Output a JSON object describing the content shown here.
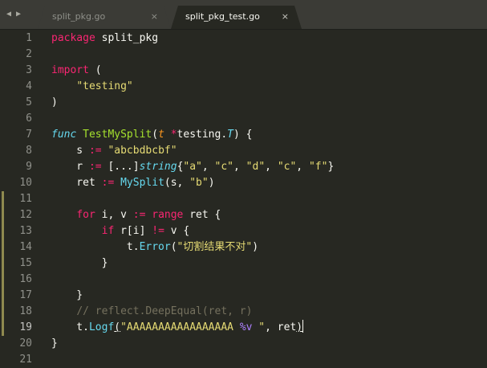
{
  "tabs": [
    {
      "label": "split_pkg.go",
      "close": "×",
      "active": false
    },
    {
      "label": "split_pkg_test.go",
      "close": "×",
      "active": true
    }
  ],
  "nav": {
    "back": "◀",
    "forward": "▶"
  },
  "lines": [
    {
      "num": "1",
      "tokens": [
        [
          "kw",
          "package"
        ],
        [
          "",
          " split_pkg"
        ]
      ]
    },
    {
      "num": "2",
      "tokens": []
    },
    {
      "num": "3",
      "tokens": [
        [
          "kw",
          "import"
        ],
        [
          "",
          " ("
        ]
      ]
    },
    {
      "num": "4",
      "tokens": [
        [
          "",
          "    "
        ],
        [
          "str",
          "\"testing\""
        ]
      ]
    },
    {
      "num": "5",
      "tokens": [
        [
          "",
          ")"
        ]
      ]
    },
    {
      "num": "6",
      "tokens": []
    },
    {
      "num": "7",
      "tokens": [
        [
          "it",
          "func"
        ],
        [
          "",
          " "
        ],
        [
          "fn",
          "TestMySplit"
        ],
        [
          "",
          "("
        ],
        [
          "param",
          "t"
        ],
        [
          "",
          " "
        ],
        [
          "kw",
          "*"
        ],
        [
          "",
          "testing."
        ],
        [
          "ty",
          "T"
        ],
        [
          "",
          ") {"
        ]
      ]
    },
    {
      "num": "8",
      "tokens": [
        [
          "",
          "    s "
        ],
        [
          "kw",
          ":="
        ],
        [
          "",
          " "
        ],
        [
          "str",
          "\"abcbdbcbf\""
        ]
      ]
    },
    {
      "num": "9",
      "tokens": [
        [
          "",
          "    r "
        ],
        [
          "kw",
          ":="
        ],
        [
          "",
          " [...]"
        ],
        [
          "ty",
          "string"
        ],
        [
          "",
          "{"
        ],
        [
          "str",
          "\"a\""
        ],
        [
          "",
          ", "
        ],
        [
          "str",
          "\"c\""
        ],
        [
          "",
          ", "
        ],
        [
          "str",
          "\"d\""
        ],
        [
          "",
          ", "
        ],
        [
          "str",
          "\"c\""
        ],
        [
          "",
          ", "
        ],
        [
          "str",
          "\"f\""
        ],
        [
          "",
          "}"
        ]
      ]
    },
    {
      "num": "10",
      "tokens": [
        [
          "",
          "    ret "
        ],
        [
          "kw",
          ":="
        ],
        [
          "",
          " "
        ],
        [
          "cyan",
          "MySplit"
        ],
        [
          "",
          "(s, "
        ],
        [
          "str",
          "\"b\""
        ],
        [
          "",
          ")"
        ]
      ]
    },
    {
      "num": "11",
      "tokens": []
    },
    {
      "num": "12",
      "tokens": [
        [
          "",
          "    "
        ],
        [
          "kw",
          "for"
        ],
        [
          "",
          " i, v "
        ],
        [
          "kw",
          ":="
        ],
        [
          "",
          " "
        ],
        [
          "kw",
          "range"
        ],
        [
          "",
          " ret {"
        ]
      ]
    },
    {
      "num": "13",
      "tokens": [
        [
          "",
          "        "
        ],
        [
          "kw",
          "if"
        ],
        [
          "",
          " r[i] "
        ],
        [
          "kw",
          "!="
        ],
        [
          "",
          " v {"
        ]
      ]
    },
    {
      "num": "14",
      "tokens": [
        [
          "",
          "            t."
        ],
        [
          "cyan",
          "Error"
        ],
        [
          "",
          "("
        ],
        [
          "str",
          "\"切割结果不对\""
        ],
        [
          "",
          ")"
        ]
      ]
    },
    {
      "num": "15",
      "tokens": [
        [
          "",
          "        }"
        ]
      ]
    },
    {
      "num": "16",
      "tokens": []
    },
    {
      "num": "17",
      "tokens": [
        [
          "",
          "    }"
        ]
      ]
    },
    {
      "num": "18",
      "tokens": [
        [
          "",
          "    "
        ],
        [
          "cmt",
          "// reflect.DeepEqual(ret, r)"
        ]
      ]
    },
    {
      "num": "19",
      "tokens": [
        [
          "",
          "    t."
        ],
        [
          "cyan",
          "Logf"
        ],
        [
          "ul",
          "("
        ],
        [
          "str",
          "\"AAAAAAAAAAAAAAAAA "
        ],
        [
          "fmt",
          "%v"
        ],
        [
          "str",
          " \""
        ],
        [
          "",
          ", ret"
        ],
        [
          "ul",
          ")"
        ],
        [
          "cursor",
          ""
        ]
      ]
    },
    {
      "num": "20",
      "tokens": [
        [
          "",
          "}"
        ]
      ]
    },
    {
      "num": "21",
      "tokens": []
    }
  ],
  "modified_lines": [
    "11",
    "12",
    "13",
    "14",
    "15",
    "16",
    "17",
    "18",
    "19"
  ],
  "current_line": "19"
}
